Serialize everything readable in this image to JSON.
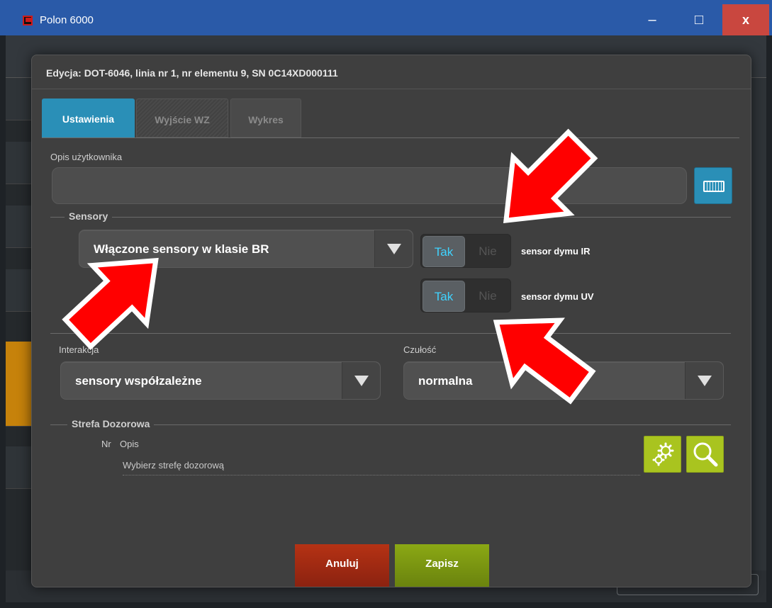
{
  "window": {
    "title": "Polon 6000",
    "minimize_label": "–",
    "maximize_label": "□",
    "close_label": "x"
  },
  "dialog": {
    "title": "Edycja: DOT-6046, linia nr 1, nr elementu 9, SN 0C14XD000111",
    "tabs": [
      {
        "label": "Ustawienia",
        "active": true
      },
      {
        "label": "Wyjście WZ",
        "active": false
      },
      {
        "label": "Wykres",
        "active": false
      }
    ],
    "user_description": {
      "label": "Opis użytkownika",
      "value": ""
    },
    "sensors": {
      "section_label": "Sensory",
      "mode_select": "Włączone sensory w klasie BR",
      "toggles": [
        {
          "on_label": "Tak",
          "off_label": "Nie",
          "state": "Tak",
          "label": "sensor dymu IR"
        },
        {
          "on_label": "Tak",
          "off_label": "Nie",
          "state": "Tak",
          "label": "sensor dymu UV"
        }
      ]
    },
    "interaction": {
      "label": "Interakcja",
      "value": "sensory współzależne"
    },
    "sensitivity": {
      "label": "Czułość",
      "value": "normalna"
    },
    "zone": {
      "section_label": "Strefa Dozorowa",
      "col_nr": "Nr",
      "col_desc": "Opis",
      "placeholder": "Wybierz strefę dozorową"
    },
    "buttons": {
      "cancel": "Anuluj",
      "save": "Zapisz"
    }
  },
  "colors": {
    "accent_blue": "#2a8fb7",
    "cancel_red": "#b53214",
    "save_green": "#8ba814",
    "icon_green": "#a9c41f",
    "annotation_arrow": "#ff0000"
  }
}
